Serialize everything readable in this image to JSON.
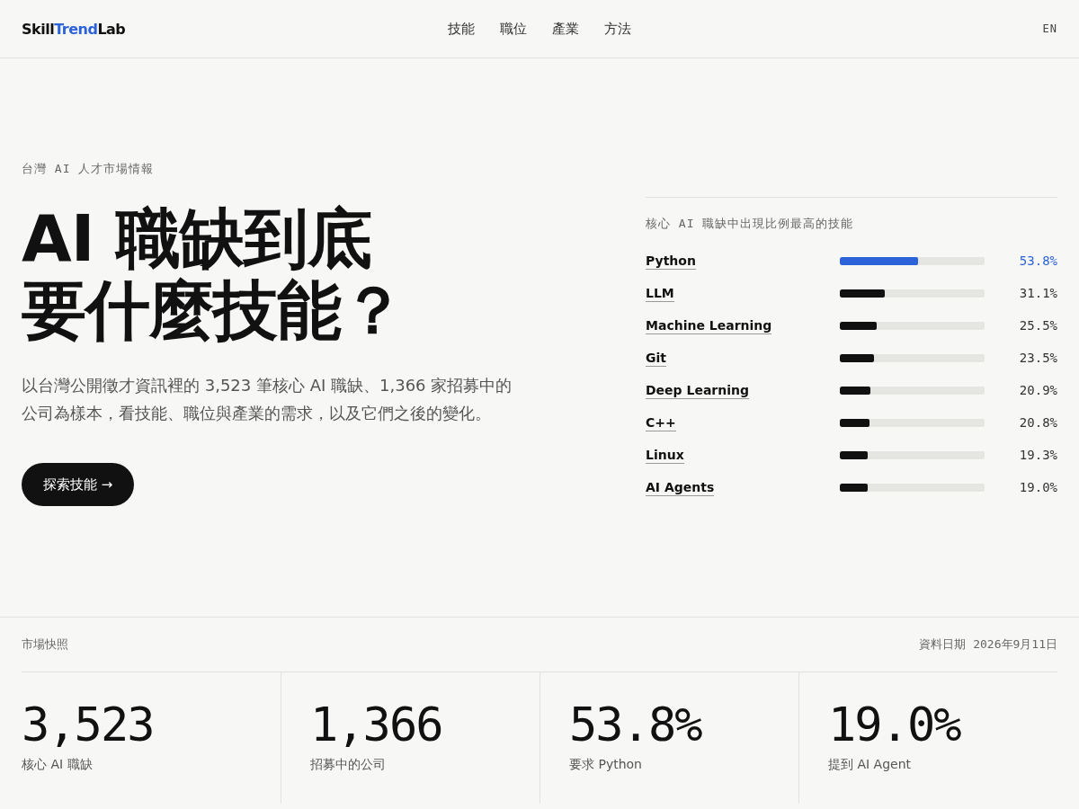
{
  "header": {
    "logo": [
      {
        "text": "Skill",
        "accent": false
      },
      {
        "text": "Trend",
        "accent": true
      },
      {
        "text": "Lab",
        "accent": false
      }
    ],
    "nav": [
      "技能",
      "職位",
      "產業",
      "方法"
    ],
    "language": "EN"
  },
  "hero": {
    "eyebrow": "台灣 AI 人才市場情報",
    "title_lines": [
      "AI 職缺到底",
      "要什麼技能？"
    ],
    "intro": "以台灣公開徵才資訊裡的 3,523 筆核心 AI 職缺、1,366 家招募中的公司為樣本，看技能、職位與產業的需求，以及它們之後的變化。",
    "cta": "探索技能 →"
  },
  "skills": {
    "title": "核心 AI 職缺中出現比例最高的技能",
    "items": [
      {
        "name": "Python",
        "level": 0.538,
        "reading": "53.8%",
        "highlighted": true
      },
      {
        "name": "LLM",
        "level": 0.311,
        "reading": "31.1%",
        "highlighted": false
      },
      {
        "name": "Machine Learning",
        "level": 0.255,
        "reading": "25.5%",
        "highlighted": false
      },
      {
        "name": "Git",
        "level": 0.235,
        "reading": "23.5%",
        "highlighted": false
      },
      {
        "name": "Deep Learning",
        "level": 0.209,
        "reading": "20.9%",
        "highlighted": false
      },
      {
        "name": "C++",
        "level": 0.208,
        "reading": "20.8%",
        "highlighted": false
      },
      {
        "name": "Linux",
        "level": 0.193,
        "reading": "19.3%",
        "highlighted": false
      },
      {
        "name": "AI Agents",
        "level": 0.19,
        "reading": "19.0%",
        "highlighted": false
      }
    ]
  },
  "snapshot": {
    "title": "市場快照",
    "date_label": "資料日期",
    "date": "2026年9月11日",
    "stats": [
      {
        "value": "3,523",
        "label": "核心 AI 職缺"
      },
      {
        "value": "1,366",
        "label": "招募中的公司"
      },
      {
        "value": "53.8%",
        "label": "要求 Python"
      },
      {
        "value": "19.0%",
        "label": "提到 AI Agent"
      }
    ]
  }
}
